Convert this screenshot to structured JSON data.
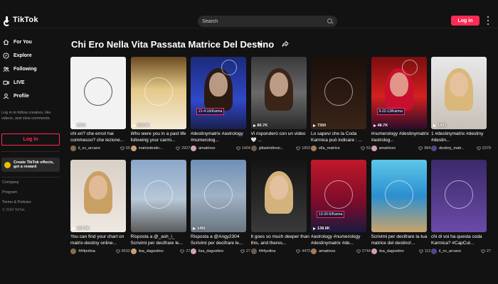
{
  "header": {
    "logo_text": "TikTok",
    "search_placeholder": "Search",
    "login_label": "Log in"
  },
  "sidebar": {
    "items": [
      {
        "label": "For You",
        "icon": "home-icon"
      },
      {
        "label": "Explore",
        "icon": "compass-icon"
      },
      {
        "label": "Following",
        "icon": "people-icon"
      },
      {
        "label": "LIVE",
        "icon": "live-icon"
      },
      {
        "label": "Profile",
        "icon": "user-icon"
      }
    ],
    "login_hint": "Log in to follow creators, like videos, and view comments.",
    "login_label": "Log in",
    "effects_label": "Create TikTok effects, get a reward",
    "footer_links": [
      "Company",
      "Program",
      "Terms & Policies"
    ],
    "copyright": "© 2024 TikTok"
  },
  "page": {
    "title": "Chi Ero Nella Vita Passata Matrice Del Destino"
  },
  "colors": {
    "accent": "#fe2c55",
    "background": "#121212"
  },
  "videos": [
    {
      "views": "6503",
      "desc": "chi eri? che errori hai commesso? che lezione...",
      "author": "il_xv_arcano",
      "likes": "65",
      "style": "chart-light"
    },
    {
      "views": "215.9K",
      "desc": "Who were you in a past life following your carmi...",
      "author": "matrixdestin...",
      "likes": "2927",
      "style": "gold-wheel"
    },
    {
      "views": "",
      "desc": "#destinymatrix #astrology #numerolog...",
      "author": "amatrixxx",
      "likes": "1404",
      "style": "blue-girl",
      "tag": "21-4-16/Karma"
    },
    {
      "views": "80.7K",
      "desc": "Vi risponderò con un video 🤍 ...",
      "author": "giliastridiresi...",
      "likes": "1802",
      "style": "dark-girl"
    },
    {
      "views": "7350",
      "desc": "Lo sapevi che la Coda Karmica può indicare : ...",
      "author": "ella_matrice",
      "likes": "53",
      "style": "dark-wheel"
    },
    {
      "views": "48.7K",
      "desc": "#numerology #destinymatrix #astrolog...",
      "author": "amatrixxx",
      "likes": "884",
      "style": "red-girl",
      "tag": "9-22-13/Karma"
    },
    {
      "views": "1491",
      "desc": "1 #destinymatrix #destiny #destin...",
      "author": "destiny_matr...",
      "likes": "2379",
      "style": "numbers-girl"
    },
    {
      "views": "167.3K",
      "desc": "You can find your chart on matrix-destiny online...",
      "author": "444polina",
      "likes": "8532",
      "style": "blonde-girl"
    },
    {
      "views": "",
      "desc": "Risposta a @_ash_i_ Scrivimi per decifrare le...",
      "author": "lisa_dagostino",
      "likes": "27",
      "style": "london"
    },
    {
      "views": "1491",
      "desc": "Risposta a @Angy2304 Scrivimi per decifrare le...",
      "author": "lisa_dagostino",
      "likes": "27",
      "style": "city"
    },
    {
      "views": "",
      "desc": "It goes so much deeper than this, and theres...",
      "author": "444polina",
      "likes": "4470",
      "style": "dark-blonde"
    },
    {
      "views": "138.6K",
      "desc": "#astrology #numerology #destinymatrix #de...",
      "author": "amatrixxx",
      "likes": "2744",
      "style": "red-wheel",
      "tag": "13-20-5/Karma"
    },
    {
      "views": "",
      "desc": "Scrivimi per decifrare la tua matrice del destino!...",
      "author": "lisa_dagostino",
      "likes": "112",
      "style": "beach-wheel"
    },
    {
      "views": "",
      "desc": "chi di voi ha questa coda Karmica? #CapCut...",
      "author": "il_xv_arcano",
      "likes": "27",
      "style": "purple-chart"
    }
  ]
}
